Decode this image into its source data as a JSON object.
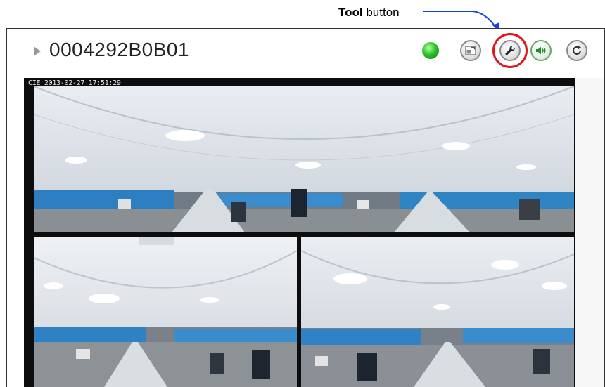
{
  "callout": {
    "bold": "Tool",
    "rest": " button"
  },
  "camera": {
    "name": "0004292B0B01",
    "status": "online",
    "osd_timestamp": "CIE 2013-02-27 17:51:29"
  },
  "toolbar": {
    "buttons": [
      {
        "name": "layout",
        "icon": "layout-icon"
      },
      {
        "name": "tool",
        "icon": "wrench-icon"
      },
      {
        "name": "audio",
        "icon": "speaker-icon"
      },
      {
        "name": "refresh",
        "icon": "refresh-icon"
      }
    ]
  },
  "colors": {
    "highlight": "#e0151b",
    "callout_line": "#1a3fe0",
    "status_led": "#2bc32b"
  }
}
